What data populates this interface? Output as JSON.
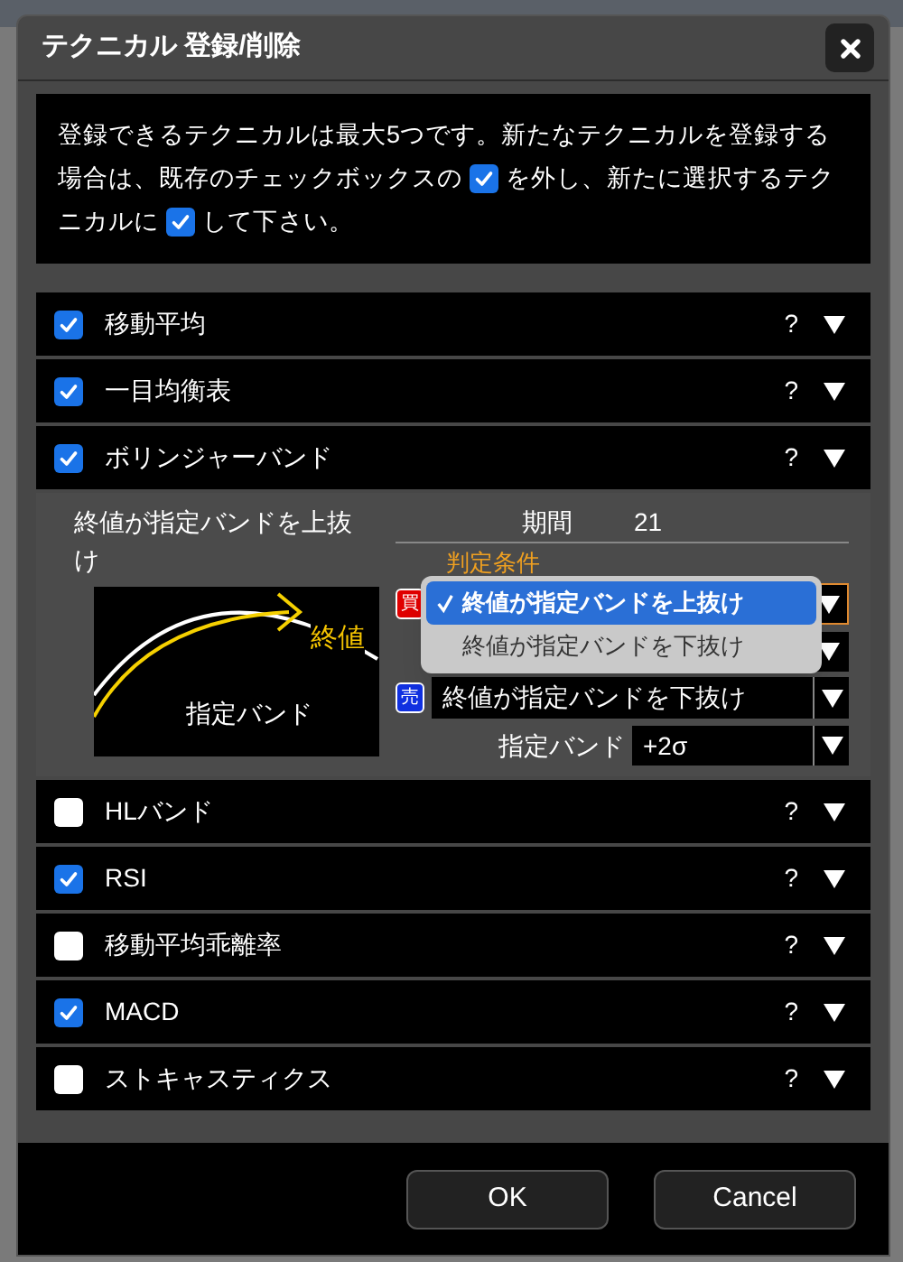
{
  "window": {
    "title": "テクニカル 登録/削除"
  },
  "notice": {
    "parts": [
      {
        "kind": "text",
        "text": "登録できるテクニカルは最大5つです。新たなテクニカルを登録する場合は、既存のチェックボックスの"
      },
      {
        "kind": "checkbox",
        "checked": true
      },
      {
        "kind": "text",
        "text": "を外し、新たに選択するテクニカルに"
      },
      {
        "kind": "checkbox",
        "checked": true
      },
      {
        "kind": "text",
        "text": "して下さい。"
      }
    ]
  },
  "items": [
    {
      "name": "移動平均",
      "checked": true,
      "help": "?"
    },
    {
      "name": "一目均衡表",
      "checked": true,
      "help": "?"
    },
    {
      "name": "ボリンジャーバンド",
      "checked": true,
      "help": "?",
      "settings": {
        "description": "終値が指定バンドを上抜け",
        "diagram": {
          "line_label": "終値",
          "band_label": "指定バンド"
        },
        "period_label": "期間",
        "period_value": "21",
        "condition_label": "判定条件",
        "buy": {
          "badge": "買",
          "menu": {
            "options": [
              {
                "label": "終値が指定バンドを上抜け",
                "selected": true
              },
              {
                "label": "終値が指定バンドを下抜け",
                "selected": false
              }
            ]
          }
        },
        "sell": {
          "badge": "売",
          "value": "終値が指定バンドを下抜け"
        },
        "band_label": "指定バンド",
        "band_value": "+2σ"
      }
    },
    {
      "name": "HLバンド",
      "checked": false,
      "help": "?"
    },
    {
      "name": "RSI",
      "checked": true,
      "help": "?"
    },
    {
      "name": "移動平均乖離率",
      "checked": false,
      "help": "?"
    },
    {
      "name": "MACD",
      "checked": true,
      "help": "?"
    },
    {
      "name": "ストキャスティクス",
      "checked": false,
      "help": "?"
    }
  ],
  "buttons": [
    "OK",
    "Cancel"
  ]
}
